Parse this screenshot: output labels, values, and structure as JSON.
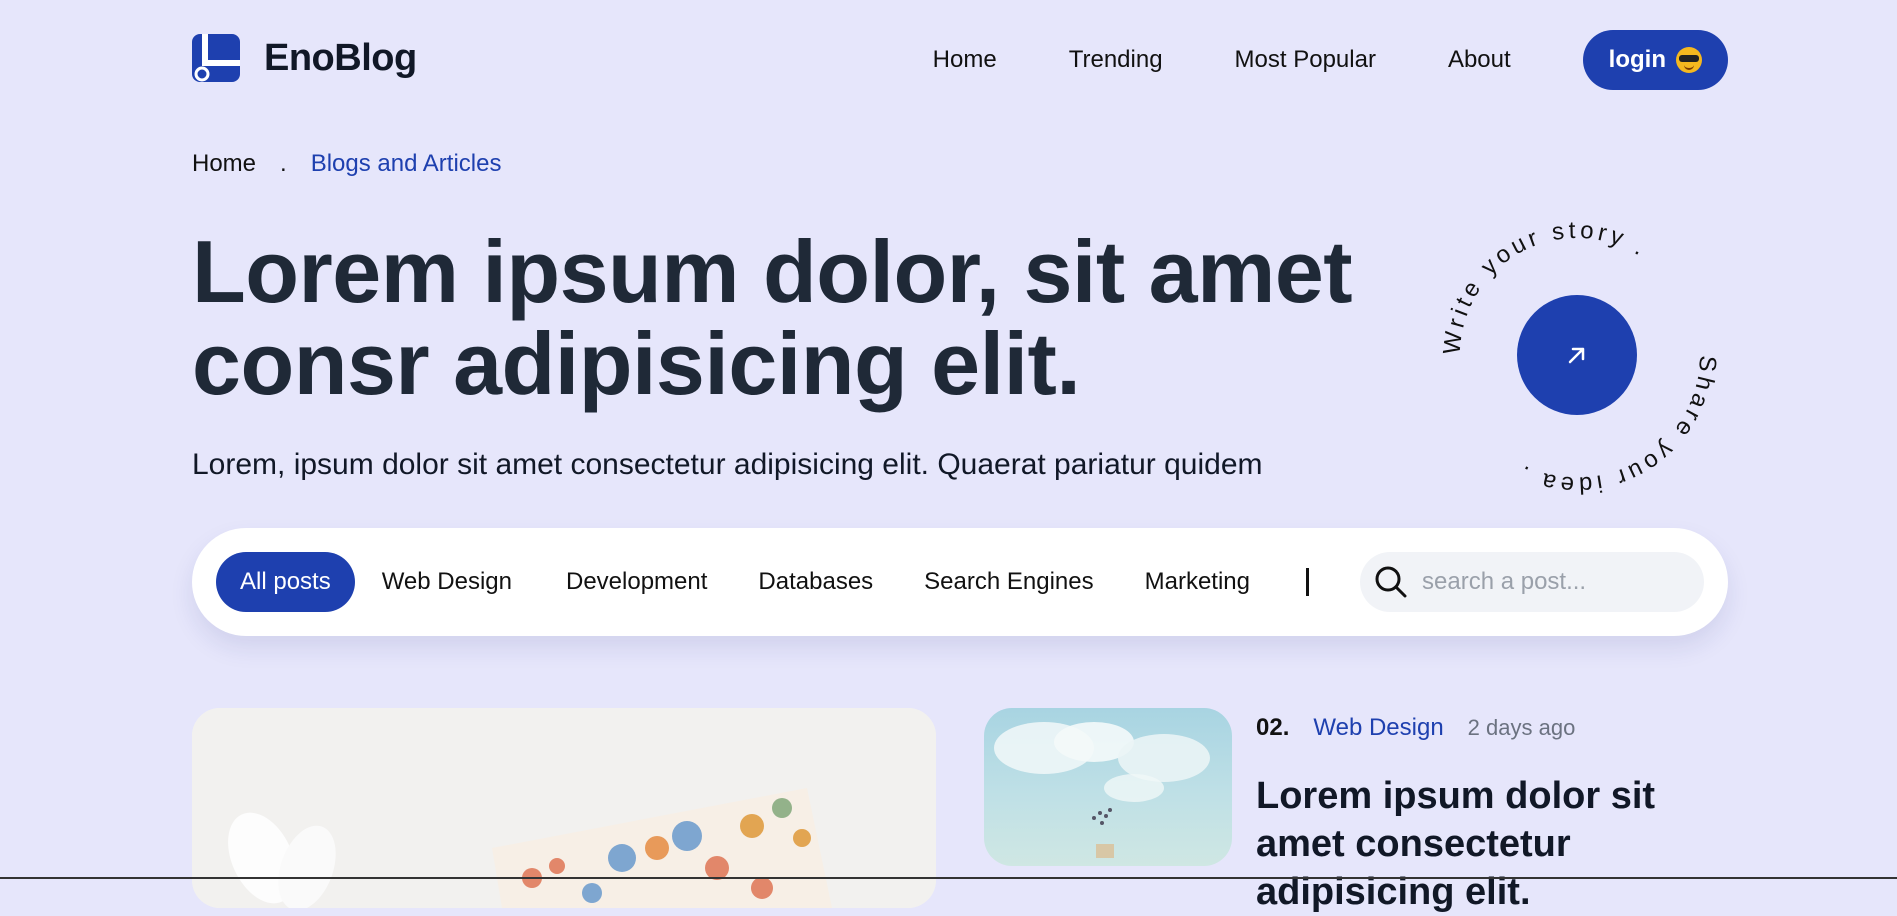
{
  "brand": {
    "name": "EnoBlog"
  },
  "nav": {
    "items": [
      "Home",
      "Trending",
      "Most Popular",
      "About"
    ],
    "login_label": "login"
  },
  "breadcrumb": {
    "home": "Home",
    "separator": ".",
    "current": "Blogs and Articles"
  },
  "hero": {
    "title": "Lorem ipsum dolor, sit amet consr adipisicing elit.",
    "subtitle": "Lorem, ipsum dolor sit amet consectetur adipisicing elit. Quaerat pariatur quidem"
  },
  "badge": {
    "ring_text_top": "Write your story .",
    "ring_text_bottom": "Share your idea ."
  },
  "filters": {
    "categories": [
      "All posts",
      "Web Design",
      "Development",
      "Databases",
      "Search Engines",
      "Marketing"
    ],
    "active": "All posts",
    "divider": "|"
  },
  "search": {
    "placeholder": "search a post..."
  },
  "post2": {
    "number": "02.",
    "category": "Web Design",
    "time": "2 days ago",
    "title": "Lorem ipsum dolor sit amet consectetur adipisicing elit."
  },
  "colors": {
    "accent": "#1e40af",
    "background": "#e6e6fb",
    "title": "#1f2937"
  }
}
